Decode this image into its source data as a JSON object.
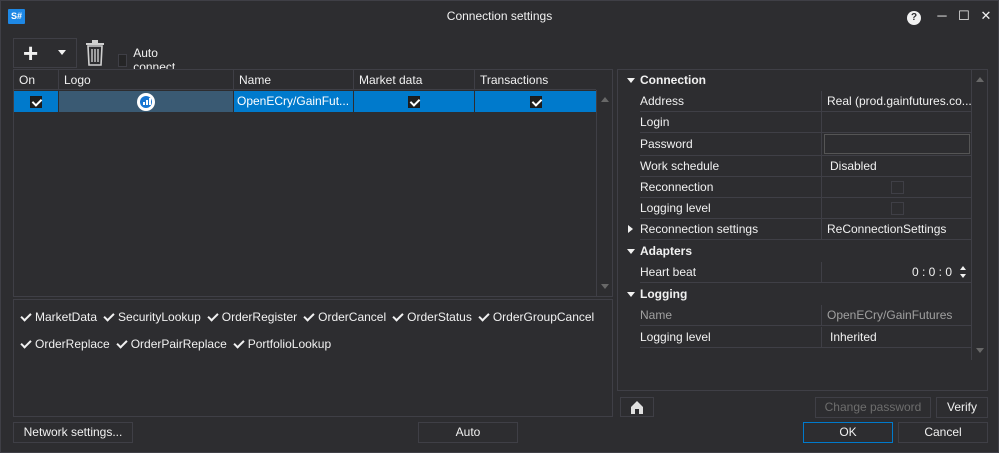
{
  "window": {
    "title": "Connection settings",
    "app_icon": "S#"
  },
  "titlebar": {
    "help": "?",
    "minimize": "─",
    "maximize": "☐",
    "close": "✕"
  },
  "toolbar": {
    "auto_connect_label": "Auto connect",
    "auto_connect_checked": false
  },
  "grid": {
    "columns": [
      "On",
      "Logo",
      "Name",
      "Market data",
      "Transactions"
    ],
    "rows": [
      {
        "on": true,
        "logo": "openecry-logo",
        "name": "OpenECry/GainFut...",
        "market_data": true,
        "transactions": true
      }
    ]
  },
  "capabilities": [
    "MarketData",
    "SecurityLookup",
    "OrderRegister",
    "OrderCancel",
    "OrderStatus",
    "OrderGroupCancel",
    "OrderReplace",
    "OrderPairReplace",
    "PortfolioLookup"
  ],
  "properties": {
    "connection": {
      "header": "Connection",
      "address_label": "Address",
      "address_value": "Real (prod.gainfutures.co...",
      "login_label": "Login",
      "login_value": "",
      "password_label": "Password",
      "password_value": "",
      "schedule_label": "Work schedule",
      "schedule_value": "Disabled",
      "reconnection_label": "Reconnection",
      "logging_label": "Logging level",
      "reconnect_settings_label": "Reconnection settings",
      "reconnect_settings_value": "ReConnectionSettings"
    },
    "adapters": {
      "header": "Adapters",
      "heartbeat_label": "Heart beat",
      "heartbeat_value": "0 : 0 : 0"
    },
    "logging": {
      "header": "Logging",
      "name_label": "Name",
      "name_value": "OpenECry/GainFutures",
      "level_label": "Logging level",
      "level_value": "Inherited"
    }
  },
  "buttons": {
    "change_password": "Change password",
    "verify": "Verify",
    "network_settings": "Network settings...",
    "auto": "Auto",
    "ok": "OK",
    "cancel": "Cancel"
  },
  "colors": {
    "accent": "#007acc",
    "background": "#2d2d30",
    "border": "#3f3f46"
  }
}
